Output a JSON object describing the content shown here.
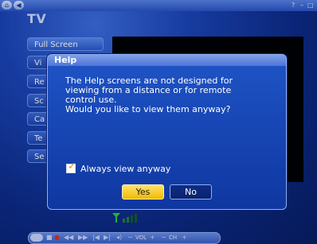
{
  "window": {
    "controls": [
      "?",
      "–",
      "□"
    ]
  },
  "tv": {
    "title": "TV",
    "menu": [
      {
        "label": "Full Screen"
      },
      {
        "label": "Vi"
      },
      {
        "label": "Re"
      },
      {
        "label": "Sc"
      },
      {
        "label": "Ca"
      },
      {
        "label": "Te"
      },
      {
        "label": "Se"
      }
    ]
  },
  "dialog": {
    "title": "Help",
    "message": "The Help screens are not designed for\nviewing from a distance or for remote\ncontrol use.\nWould you like to view them anyway?",
    "checkbox_label": "Always view anyway",
    "checkbox_checked": true,
    "yes_label": "Yes",
    "no_label": "No"
  },
  "transport": {
    "vol_label": "VOL",
    "ch_label": "CH"
  },
  "colors": {
    "accent_yellow": "#f2b900",
    "dialog_blue": "#1f54c6",
    "signal_green": "#2ecc40"
  }
}
